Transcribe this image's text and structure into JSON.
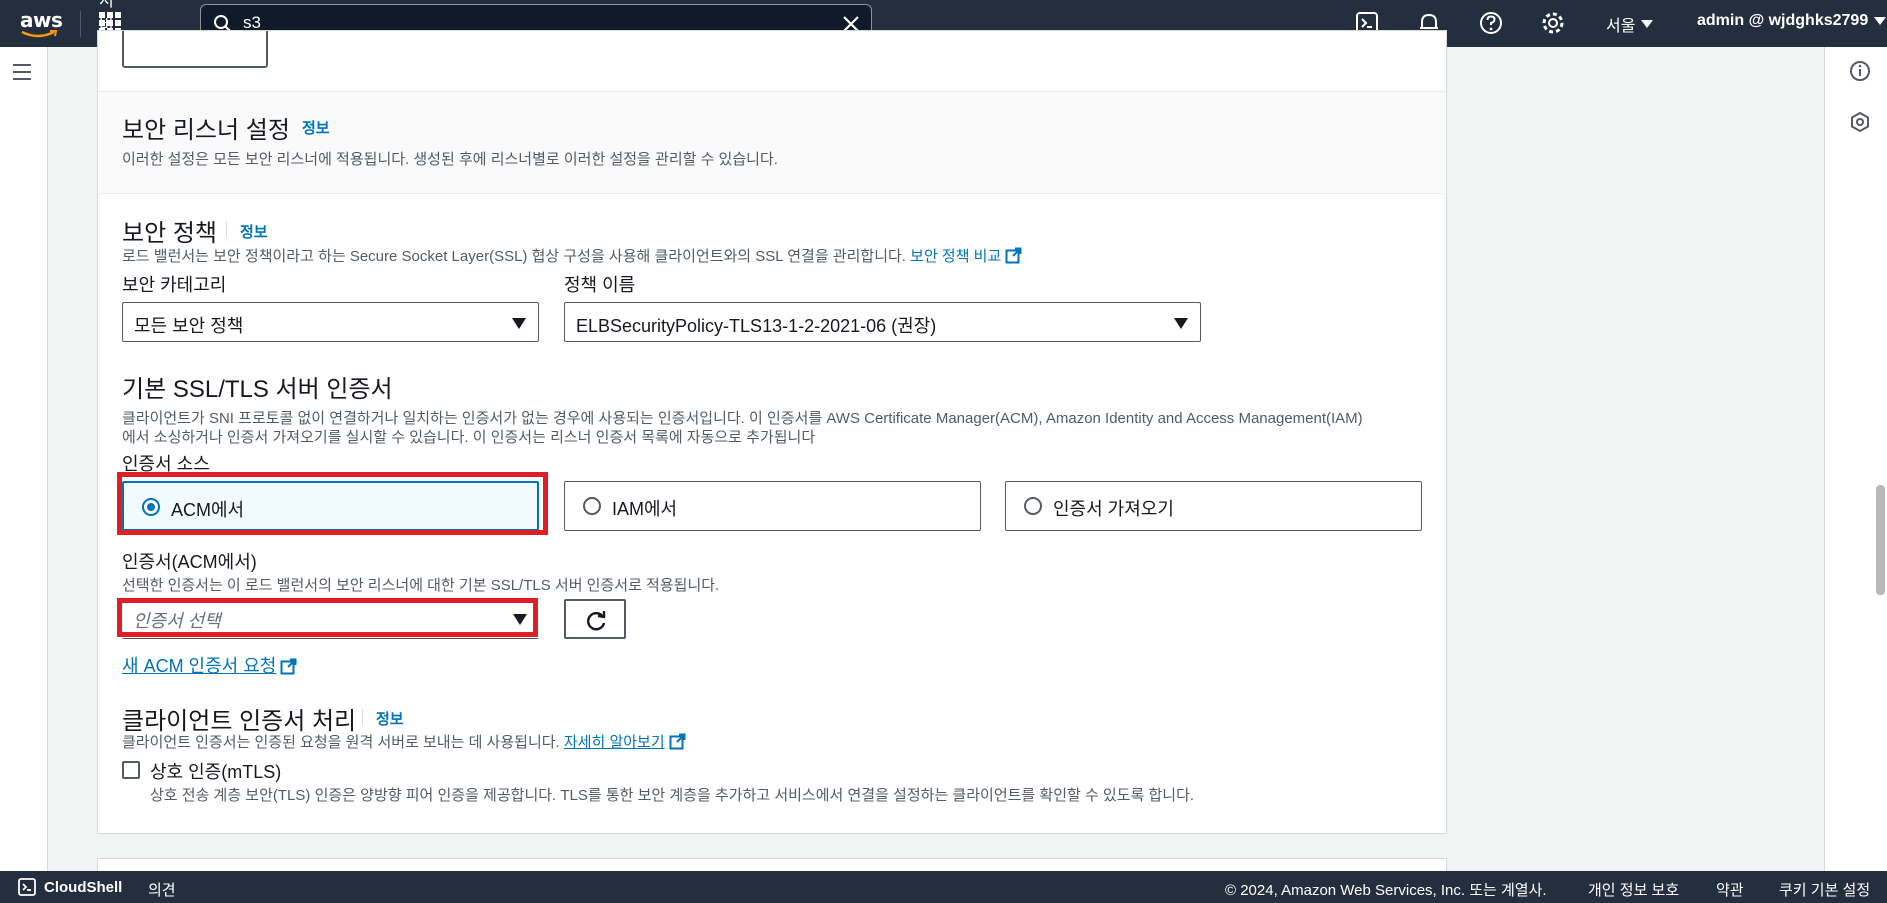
{
  "topnav": {
    "logo": "aws",
    "services_label": "서비스",
    "search_value": "s3",
    "region": "서울",
    "account": "admin @ wjdghks2799"
  },
  "section_header": {
    "title": "보안 리스너 설정",
    "info": "정보",
    "description": "이러한 설정은 모든 보안 리스너에 적용됩니다. 생성된 후에 리스너별로 이러한 설정을 관리할 수 있습니다."
  },
  "security_policy": {
    "title": "보안 정책",
    "info": "정보",
    "description": "로드 밸런서는 보안 정책이라고 하는 Secure Socket Layer(SSL) 협상 구성을 사용해 클라이언트와의 SSL 연결을 관리합니다.",
    "compare_link": "보안 정책 비교",
    "category_label": "보안 카테고리",
    "category_value": "모든 보안 정책",
    "policy_label": "정책 이름",
    "policy_value": "ELBSecurityPolicy-TLS13-1-2-2021-06 (권장)"
  },
  "default_cert": {
    "title": "기본 SSL/TLS 서버 인증서",
    "description_line1": "클라이언트가 SNI 프로토콜 없이 연결하거나 일치하는 인증서가 없는 경우에 사용되는 인증서입니다. 이 인증서를 AWS Certificate Manager(ACM), Amazon Identity and Access Management(IAM)",
    "description_line2": "에서 소싱하거나 인증서 가져오기를 실시할 수 있습니다. 이 인증서는 리스너 인증서 목록에 자동으로 추가됩니다",
    "source_label": "인증서 소스",
    "sources": [
      {
        "label": "ACM에서",
        "selected": true
      },
      {
        "label": "IAM에서",
        "selected": false
      },
      {
        "label": "인증서 가져오기",
        "selected": false
      }
    ],
    "cert_label": "인증서(ACM에서)",
    "cert_description": "선택한 인증서는 이 로드 밸런서의 보안 리스너에 대한 기본 SSL/TLS 서버 인증서로 적용됩니다.",
    "cert_placeholder": "인증서 선택",
    "request_link": "새 ACM 인증서 요청"
  },
  "client_cert": {
    "title": "클라이언트 인증서 처리",
    "info": "정보",
    "description": "클라이언트 인증서는 인증된 요청을 원격 서버로 보내는 데 사용됩니다.",
    "learn_more": "자세히 알아보기",
    "mtls_label": "상호 인증(mTLS)",
    "mtls_checked": false,
    "mtls_description": "상호 전송 계층 보안(TLS) 인증은 양방향 피어 인증을 제공합니다. TLS를 통한 보안 계층을 추가하고 서비스에서 연결을 설정하는 클라이언트를 확인할 수 있도록 합니다."
  },
  "footer": {
    "cloudshell": "CloudShell",
    "feedback": "의견",
    "copyright": "© 2024, Amazon Web Services, Inc. 또는 계열사.",
    "privacy": "개인 정보 보호",
    "terms": "약관",
    "cookies": "쿠키 기본 설정"
  },
  "colors": {
    "nav_bg": "#232f3e",
    "link": "#0073bb",
    "highlight_red": "#e01e25"
  }
}
